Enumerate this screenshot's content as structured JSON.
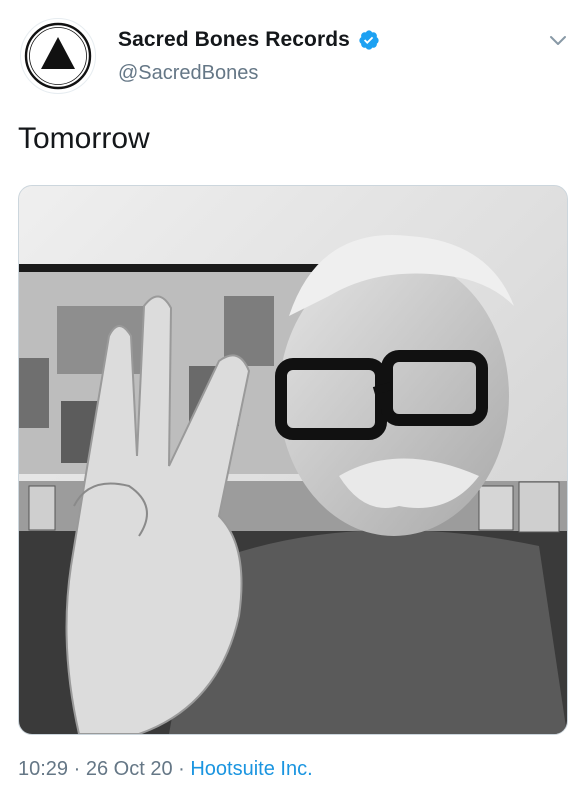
{
  "author": {
    "name": "Sacred Bones Records",
    "handle": "@SacredBones",
    "verified": true
  },
  "tweet": {
    "text": "Tomorrow"
  },
  "media": {
    "description_icon": "photo-icon"
  },
  "footer": {
    "time": "10:29",
    "separator1": " · ",
    "date": "26 Oct 20",
    "separator2": " · ",
    "source": "Hootsuite Inc."
  },
  "colors": {
    "link": "#1b95e0",
    "verified": "#1da1f2",
    "secondary_text": "#657786"
  },
  "icons": {
    "menu": "chevron-down-icon",
    "verified": "verified-badge-icon",
    "avatar": "triangle-logo-icon"
  }
}
